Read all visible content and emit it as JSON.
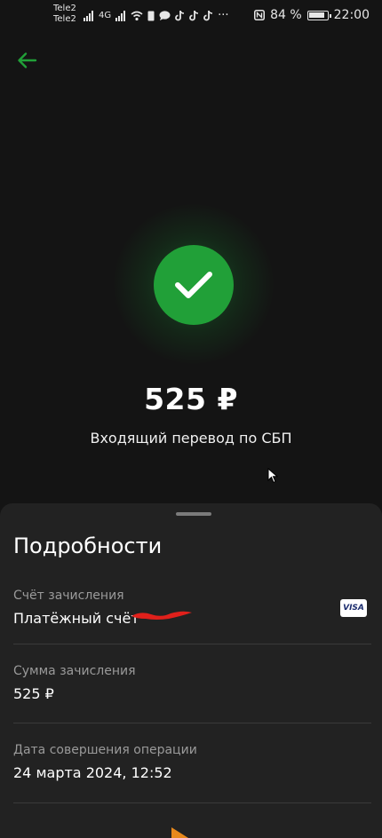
{
  "statusbar": {
    "carrier1": "Tele2",
    "carrier2": "Tele2",
    "network": "4G",
    "battery_pct": "84 %",
    "time": "22:00",
    "more": "···"
  },
  "header": {
    "back_icon": "back-arrow-icon"
  },
  "result": {
    "icon": "checkmark-icon",
    "amount": "525 ₽",
    "description": "Входящий перевод по СБП"
  },
  "details": {
    "title": "Подробности",
    "account_label": "Счёт зачисления",
    "account_value": "Платёжный счёт",
    "card_brand": "VISA",
    "sum_label": "Сумма зачисления",
    "sum_value": "525 ₽",
    "date_label": "Дата совершения операции",
    "date_value": "24 марта 2024, 12:52"
  },
  "colors": {
    "accent": "#21a038",
    "background": "#141414",
    "sheet": "#222222",
    "label": "#9a9a9a"
  }
}
